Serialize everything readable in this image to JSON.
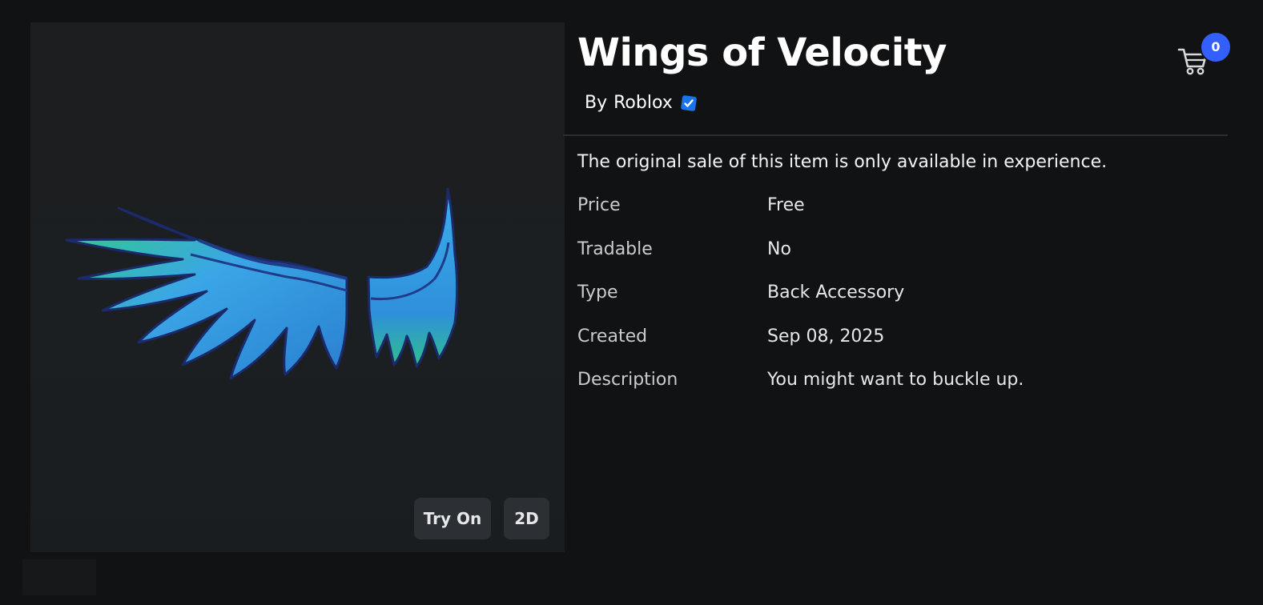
{
  "item": {
    "title": "Wings of Velocity",
    "creator_prefix": "By",
    "creator_name": "Roblox",
    "creator_verified": true,
    "notice": "The original sale of this item is only available in experience."
  },
  "details": [
    {
      "label": "Price",
      "value": "Free"
    },
    {
      "label": "Tradable",
      "value": "No"
    },
    {
      "label": "Type",
      "value": "Back Accessory"
    },
    {
      "label": "Created",
      "value": "Sep 08, 2025"
    },
    {
      "label": "Description",
      "value": "You might want to buckle up."
    }
  ],
  "preview": {
    "try_on_label": "Try On",
    "view_mode_label": "2D",
    "image_subject": "blue-green feathered wings"
  },
  "cart": {
    "count": "0",
    "icon": "shopping-cart-icon"
  },
  "colors": {
    "background": "#111214",
    "accent_blue": "#335fff",
    "verified_blue": "#1a73e8",
    "wing_blue": "#3aa6e6",
    "wing_green": "#2fd07a"
  }
}
